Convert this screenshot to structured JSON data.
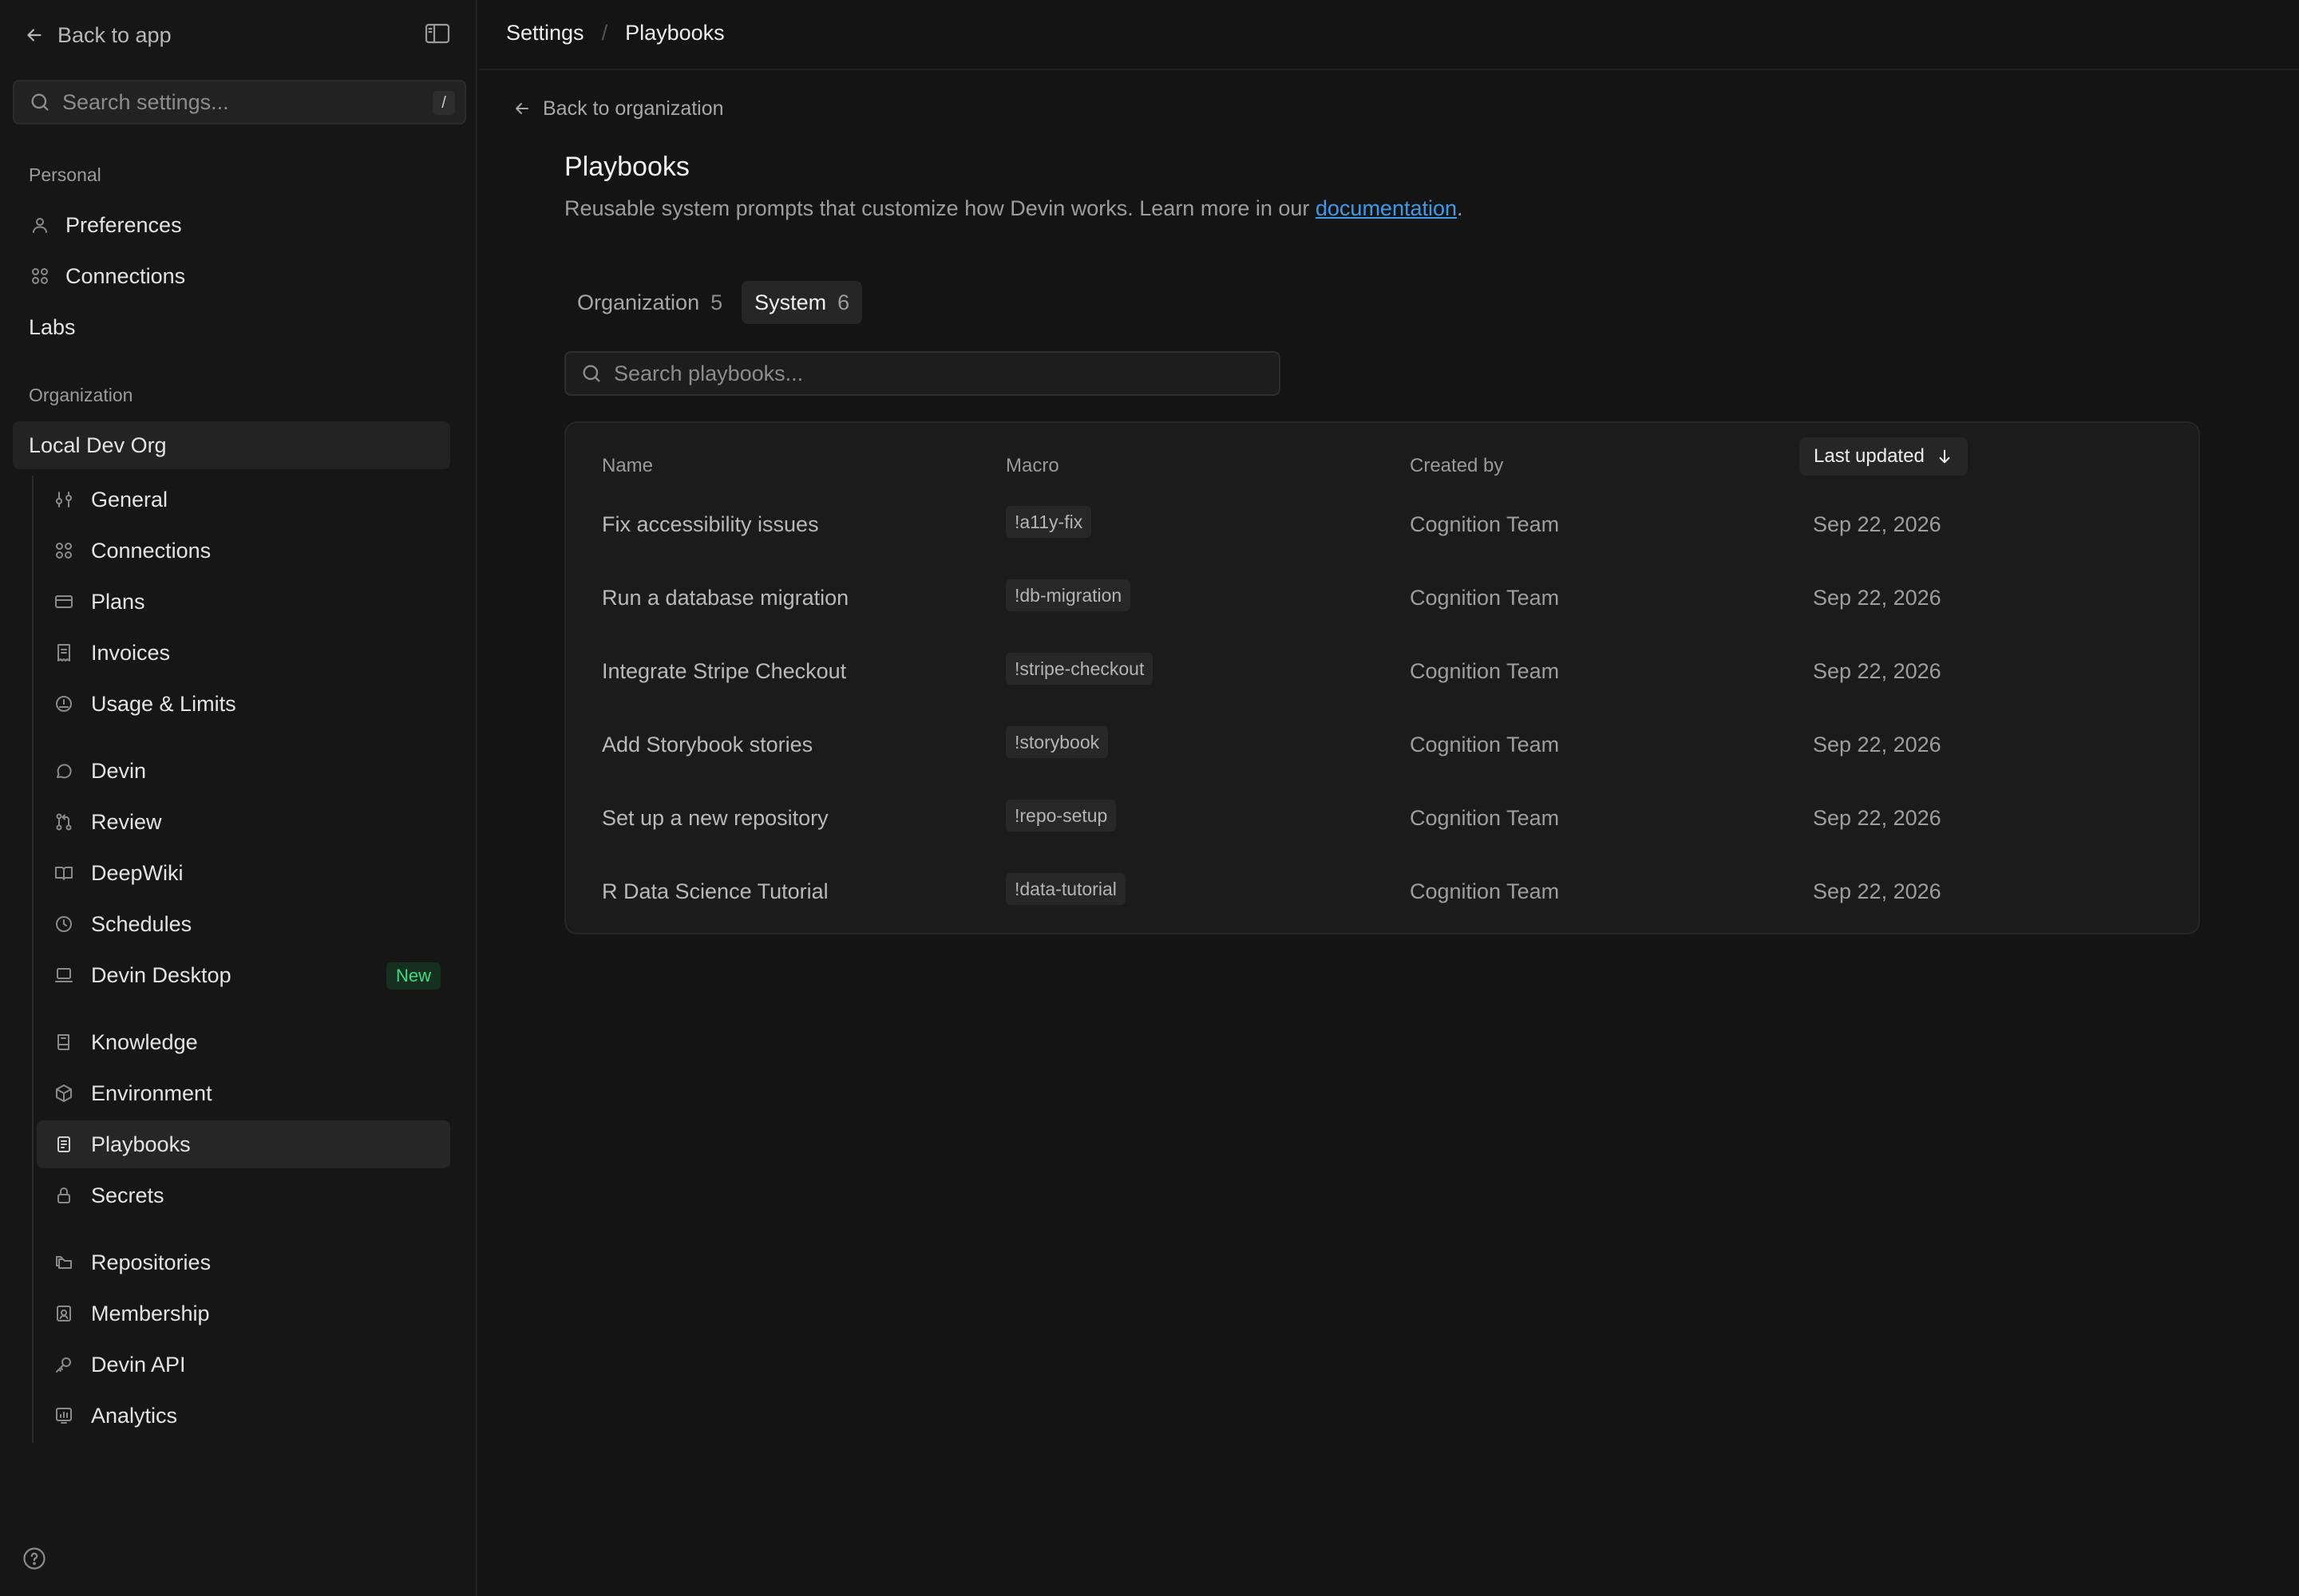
{
  "sidebar": {
    "back_label": "Back to app",
    "search_placeholder": "Search settings...",
    "search_shortcut": "/",
    "personal_label": "Personal",
    "personal_items": [
      {
        "label": "Preferences",
        "icon": "user-icon"
      },
      {
        "label": "Connections",
        "icon": "grid-icon"
      }
    ],
    "labs_label": "Labs",
    "organization_label": "Organization",
    "org_name": "Local Dev Org",
    "org_items": [
      {
        "label": "General",
        "icon": "sliders-icon"
      },
      {
        "label": "Connections",
        "icon": "grid-icon"
      },
      {
        "label": "Plans",
        "icon": "credit-card-icon"
      },
      {
        "label": "Invoices",
        "icon": "receipt-icon"
      },
      {
        "label": "Usage & Limits",
        "icon": "gauge-icon"
      },
      {
        "label": "Devin",
        "icon": "chat-icon"
      },
      {
        "label": "Review",
        "icon": "git-pull-request-icon"
      },
      {
        "label": "DeepWiki",
        "icon": "book-open-icon"
      },
      {
        "label": "Schedules",
        "icon": "clock-icon"
      },
      {
        "label": "Devin Desktop",
        "icon": "laptop-icon",
        "badge": "New"
      },
      {
        "label": "Knowledge",
        "icon": "book-icon"
      },
      {
        "label": "Environment",
        "icon": "box-icon"
      },
      {
        "label": "Playbooks",
        "icon": "file-text-icon",
        "active": true
      },
      {
        "label": "Secrets",
        "icon": "lock-icon"
      },
      {
        "label": "Repositories",
        "icon": "folders-icon"
      },
      {
        "label": "Membership",
        "icon": "id-card-icon"
      },
      {
        "label": "Devin API",
        "icon": "key-icon"
      },
      {
        "label": "Analytics",
        "icon": "bar-chart-icon"
      }
    ],
    "badge_color": "#3ddc84"
  },
  "breadcrumb": {
    "root": "Settings",
    "separator": "/",
    "current": "Playbooks"
  },
  "main": {
    "back_label": "Back to organization",
    "title": "Playbooks",
    "description": "Reusable system prompts that customize how Devin works. Learn more in our ",
    "description_link": "documentation",
    "description_end": ".",
    "link_color": "#3d9ae8",
    "tabs": [
      {
        "label": "Organization",
        "count": "5",
        "active": false
      },
      {
        "label": "System",
        "count": "6",
        "active": true
      }
    ],
    "search_placeholder": "Search playbooks...",
    "table": {
      "columns": [
        "Name",
        "Macro",
        "Created by",
        "Last updated"
      ],
      "sort_column": "Last updated",
      "sort_direction": "descending",
      "rows": [
        {
          "name": "Fix accessibility issues",
          "macro": "!a11y-fix",
          "created_by": "Cognition Team",
          "updated": "Sep 22, 2026"
        },
        {
          "name": "Run a database migration",
          "macro": "!db-migration",
          "created_by": "Cognition Team",
          "updated": "Sep 22, 2026"
        },
        {
          "name": "Integrate Stripe Checkout",
          "macro": "!stripe-checkout",
          "created_by": "Cognition Team",
          "updated": "Sep 22, 2026"
        },
        {
          "name": "Add Storybook stories",
          "macro": "!storybook",
          "created_by": "Cognition Team",
          "updated": "Sep 22, 2026"
        },
        {
          "name": "Set up a new repository",
          "macro": "!repo-setup",
          "created_by": "Cognition Team",
          "updated": "Sep 22, 2026"
        },
        {
          "name": "R Data Science Tutorial",
          "macro": "!data-tutorial",
          "created_by": "Cognition Team",
          "updated": "Sep 22, 2026"
        }
      ]
    }
  }
}
